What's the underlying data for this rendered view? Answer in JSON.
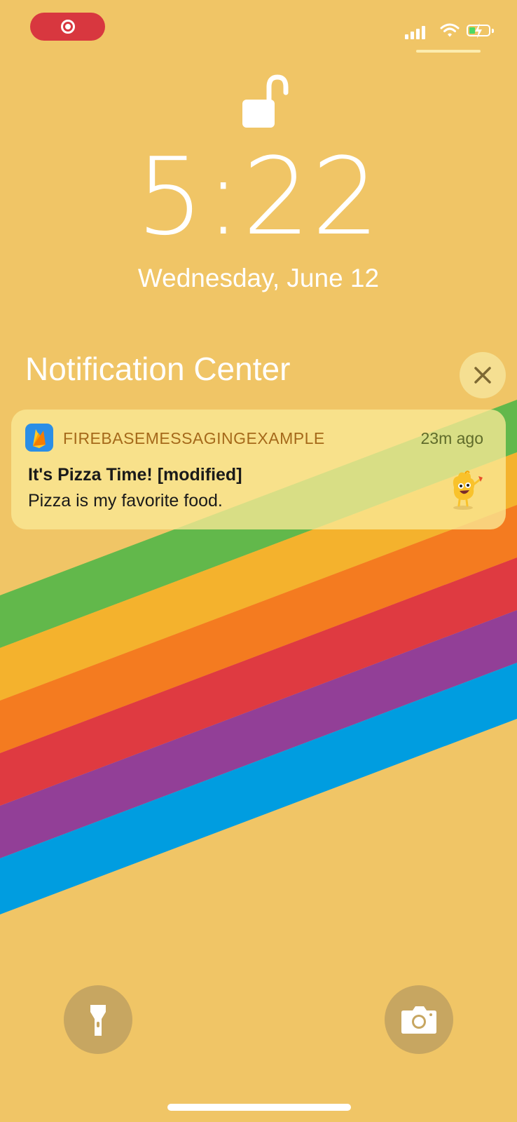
{
  "status_bar": {
    "recording_icon": "screen-recording-icon",
    "signal_icon": "cellular-signal-icon",
    "wifi_icon": "wifi-icon",
    "battery_icon": "battery-charging-icon",
    "battery_level": 0.3
  },
  "lock": {
    "icon": "unlocked-padlock-icon",
    "time": "5:22",
    "date": "Wednesday, June 12"
  },
  "notification_center": {
    "title": "Notification Center",
    "close_icon": "close-icon"
  },
  "notification": {
    "app_icon": "firebase-icon",
    "app_name": "FIREBASEMESSAGINGEXAMPLE",
    "time": "23m ago",
    "title": "It's Pizza Time! [modified]",
    "body": "Pizza is my favorite food.",
    "attachment_icon": "pizza-mascot-image"
  },
  "quick_actions": {
    "flashlight_icon": "flashlight-icon",
    "camera_icon": "camera-icon"
  },
  "colors": {
    "wallpaper_background": "#f0c566",
    "stripe_green": "#62b84b",
    "stripe_yellow": "#f4b22d",
    "stripe_orange": "#f47b20",
    "stripe_red": "#df3a41",
    "stripe_purple": "#923f97",
    "stripe_blue": "#009de0",
    "recording_pill": "#d8373f"
  }
}
